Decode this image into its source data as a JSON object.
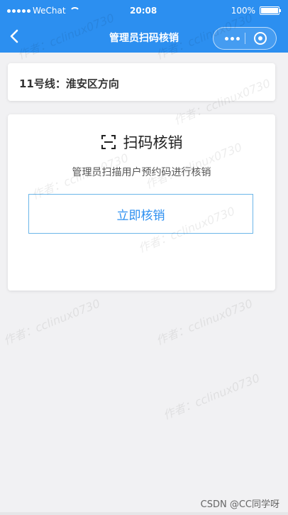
{
  "status_bar": {
    "carrier": "WeChat",
    "time": "20:08",
    "battery": "100%"
  },
  "nav": {
    "title": "管理员扫码核销"
  },
  "line": {
    "label": "11号线：淮安区方向"
  },
  "scan": {
    "title": "扫码核销",
    "description": "管理员扫描用户预约码进行核销",
    "button_label": "立即核销"
  },
  "watermark": {
    "text": "作者：cclinux0730"
  },
  "footer": {
    "source": "CSDN @CC同学呀"
  },
  "colors": {
    "primary": "#2c8ff0",
    "background": "#f1f1f3",
    "button_border": "#6cb6e9"
  },
  "icons": {
    "back": "chevron-left-icon",
    "more": "more-dots-icon",
    "close": "target-icon",
    "scan": "scan-icon",
    "signal": "signal-dots-icon",
    "wifi": "wifi-icon",
    "battery": "battery-icon"
  }
}
